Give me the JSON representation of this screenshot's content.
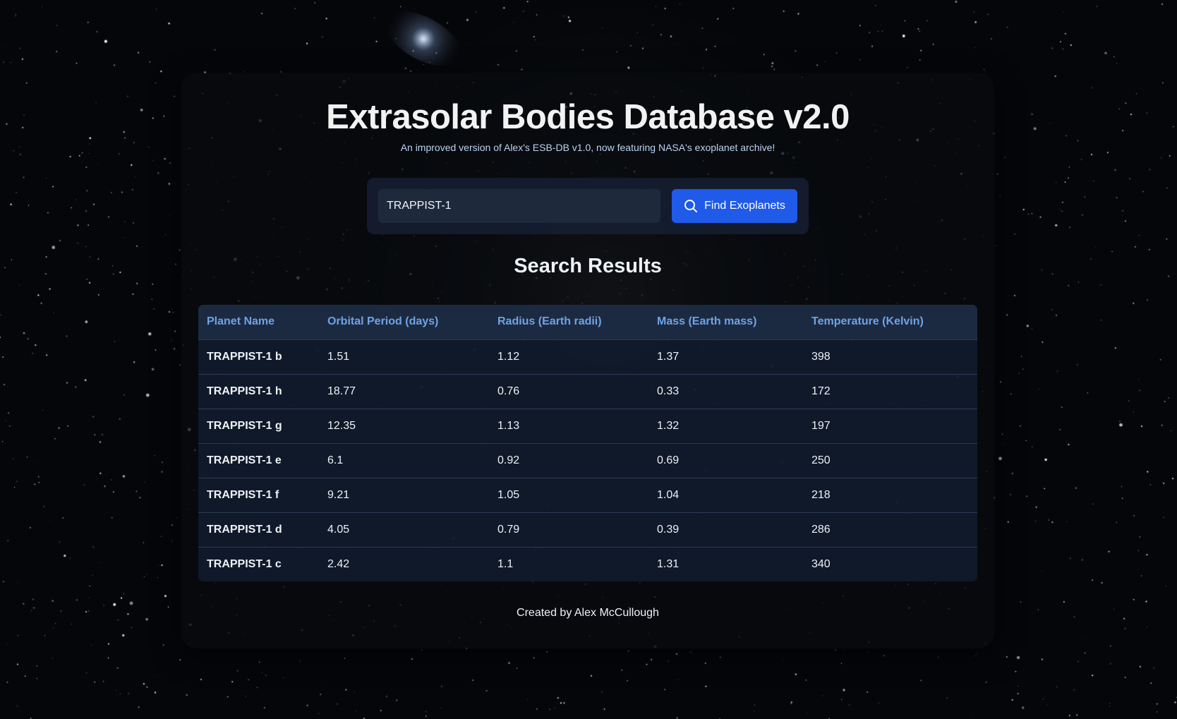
{
  "header": {
    "title": "Extrasolar Bodies Database v2.0",
    "subtitle": "An improved version of Alex's ESB-DB v1.0, now featuring NASA's exoplanet archive!"
  },
  "search": {
    "value": "TRAPPIST-1",
    "button_label": "Find Exoplanets",
    "button_icon": "search-icon"
  },
  "results": {
    "title": "Search Results",
    "columns": [
      "Planet Name",
      "Orbital Period (days)",
      "Radius (Earth radii)",
      "Mass (Earth mass)",
      "Temperature (Kelvin)"
    ],
    "rows": [
      [
        "TRAPPIST-1 b",
        "1.51",
        "1.12",
        "1.37",
        "398"
      ],
      [
        "TRAPPIST-1 h",
        "18.77",
        "0.76",
        "0.33",
        "172"
      ],
      [
        "TRAPPIST-1 g",
        "12.35",
        "1.13",
        "1.32",
        "197"
      ],
      [
        "TRAPPIST-1 e",
        "6.1",
        "0.92",
        "0.69",
        "250"
      ],
      [
        "TRAPPIST-1 f",
        "9.21",
        "1.05",
        "1.04",
        "218"
      ],
      [
        "TRAPPIST-1 d",
        "4.05",
        "0.79",
        "0.39",
        "286"
      ],
      [
        "TRAPPIST-1 c",
        "2.42",
        "1.1",
        "1.31",
        "340"
      ]
    ]
  },
  "footer": {
    "text": "Created by Alex McCullough"
  },
  "colors": {
    "accent": "#1f5ae8",
    "header_text": "#6ea3e6",
    "background": "#06070b"
  }
}
